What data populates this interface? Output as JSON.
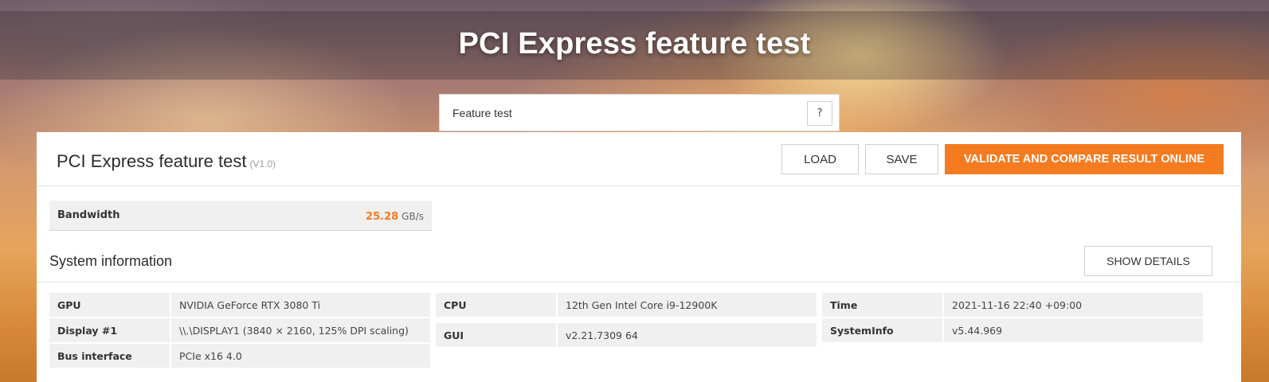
{
  "page": {
    "title": "PCI Express feature test"
  },
  "tab": {
    "label": "Feature test",
    "help_label": "?"
  },
  "result": {
    "title": "PCI Express feature test",
    "version": "(V1.0)",
    "buttons": {
      "load": "LOAD",
      "save": "SAVE",
      "validate": "VALIDATE AND COMPARE RESULT ONLINE"
    },
    "bandwidth": {
      "label": "Bandwidth",
      "value": "25.28",
      "unit": "GB/s"
    }
  },
  "system_info": {
    "title": "System information",
    "show_details": "SHOW DETAILS",
    "col1": [
      {
        "key": "GPU",
        "value": "NVIDIA GeForce RTX 3080 Ti"
      },
      {
        "key": "Display #1",
        "value": "\\\\.\\DISPLAY1 (3840 × 2160, 125% DPI scaling)"
      },
      {
        "key": "Bus interface",
        "value": "PCIe x16 4.0"
      }
    ],
    "col2": [
      {
        "key": "CPU",
        "value": "12th Gen Intel Core i9-12900K"
      },
      {
        "key": "GUI",
        "value": "v2.21.7309 64"
      }
    ],
    "col3": [
      {
        "key": "Time",
        "value": "2021-11-16 22:40 +09:00"
      },
      {
        "key": "SystemInfo",
        "value": "v5.44.969"
      }
    ]
  },
  "colors": {
    "accent": "#f47b1f"
  }
}
